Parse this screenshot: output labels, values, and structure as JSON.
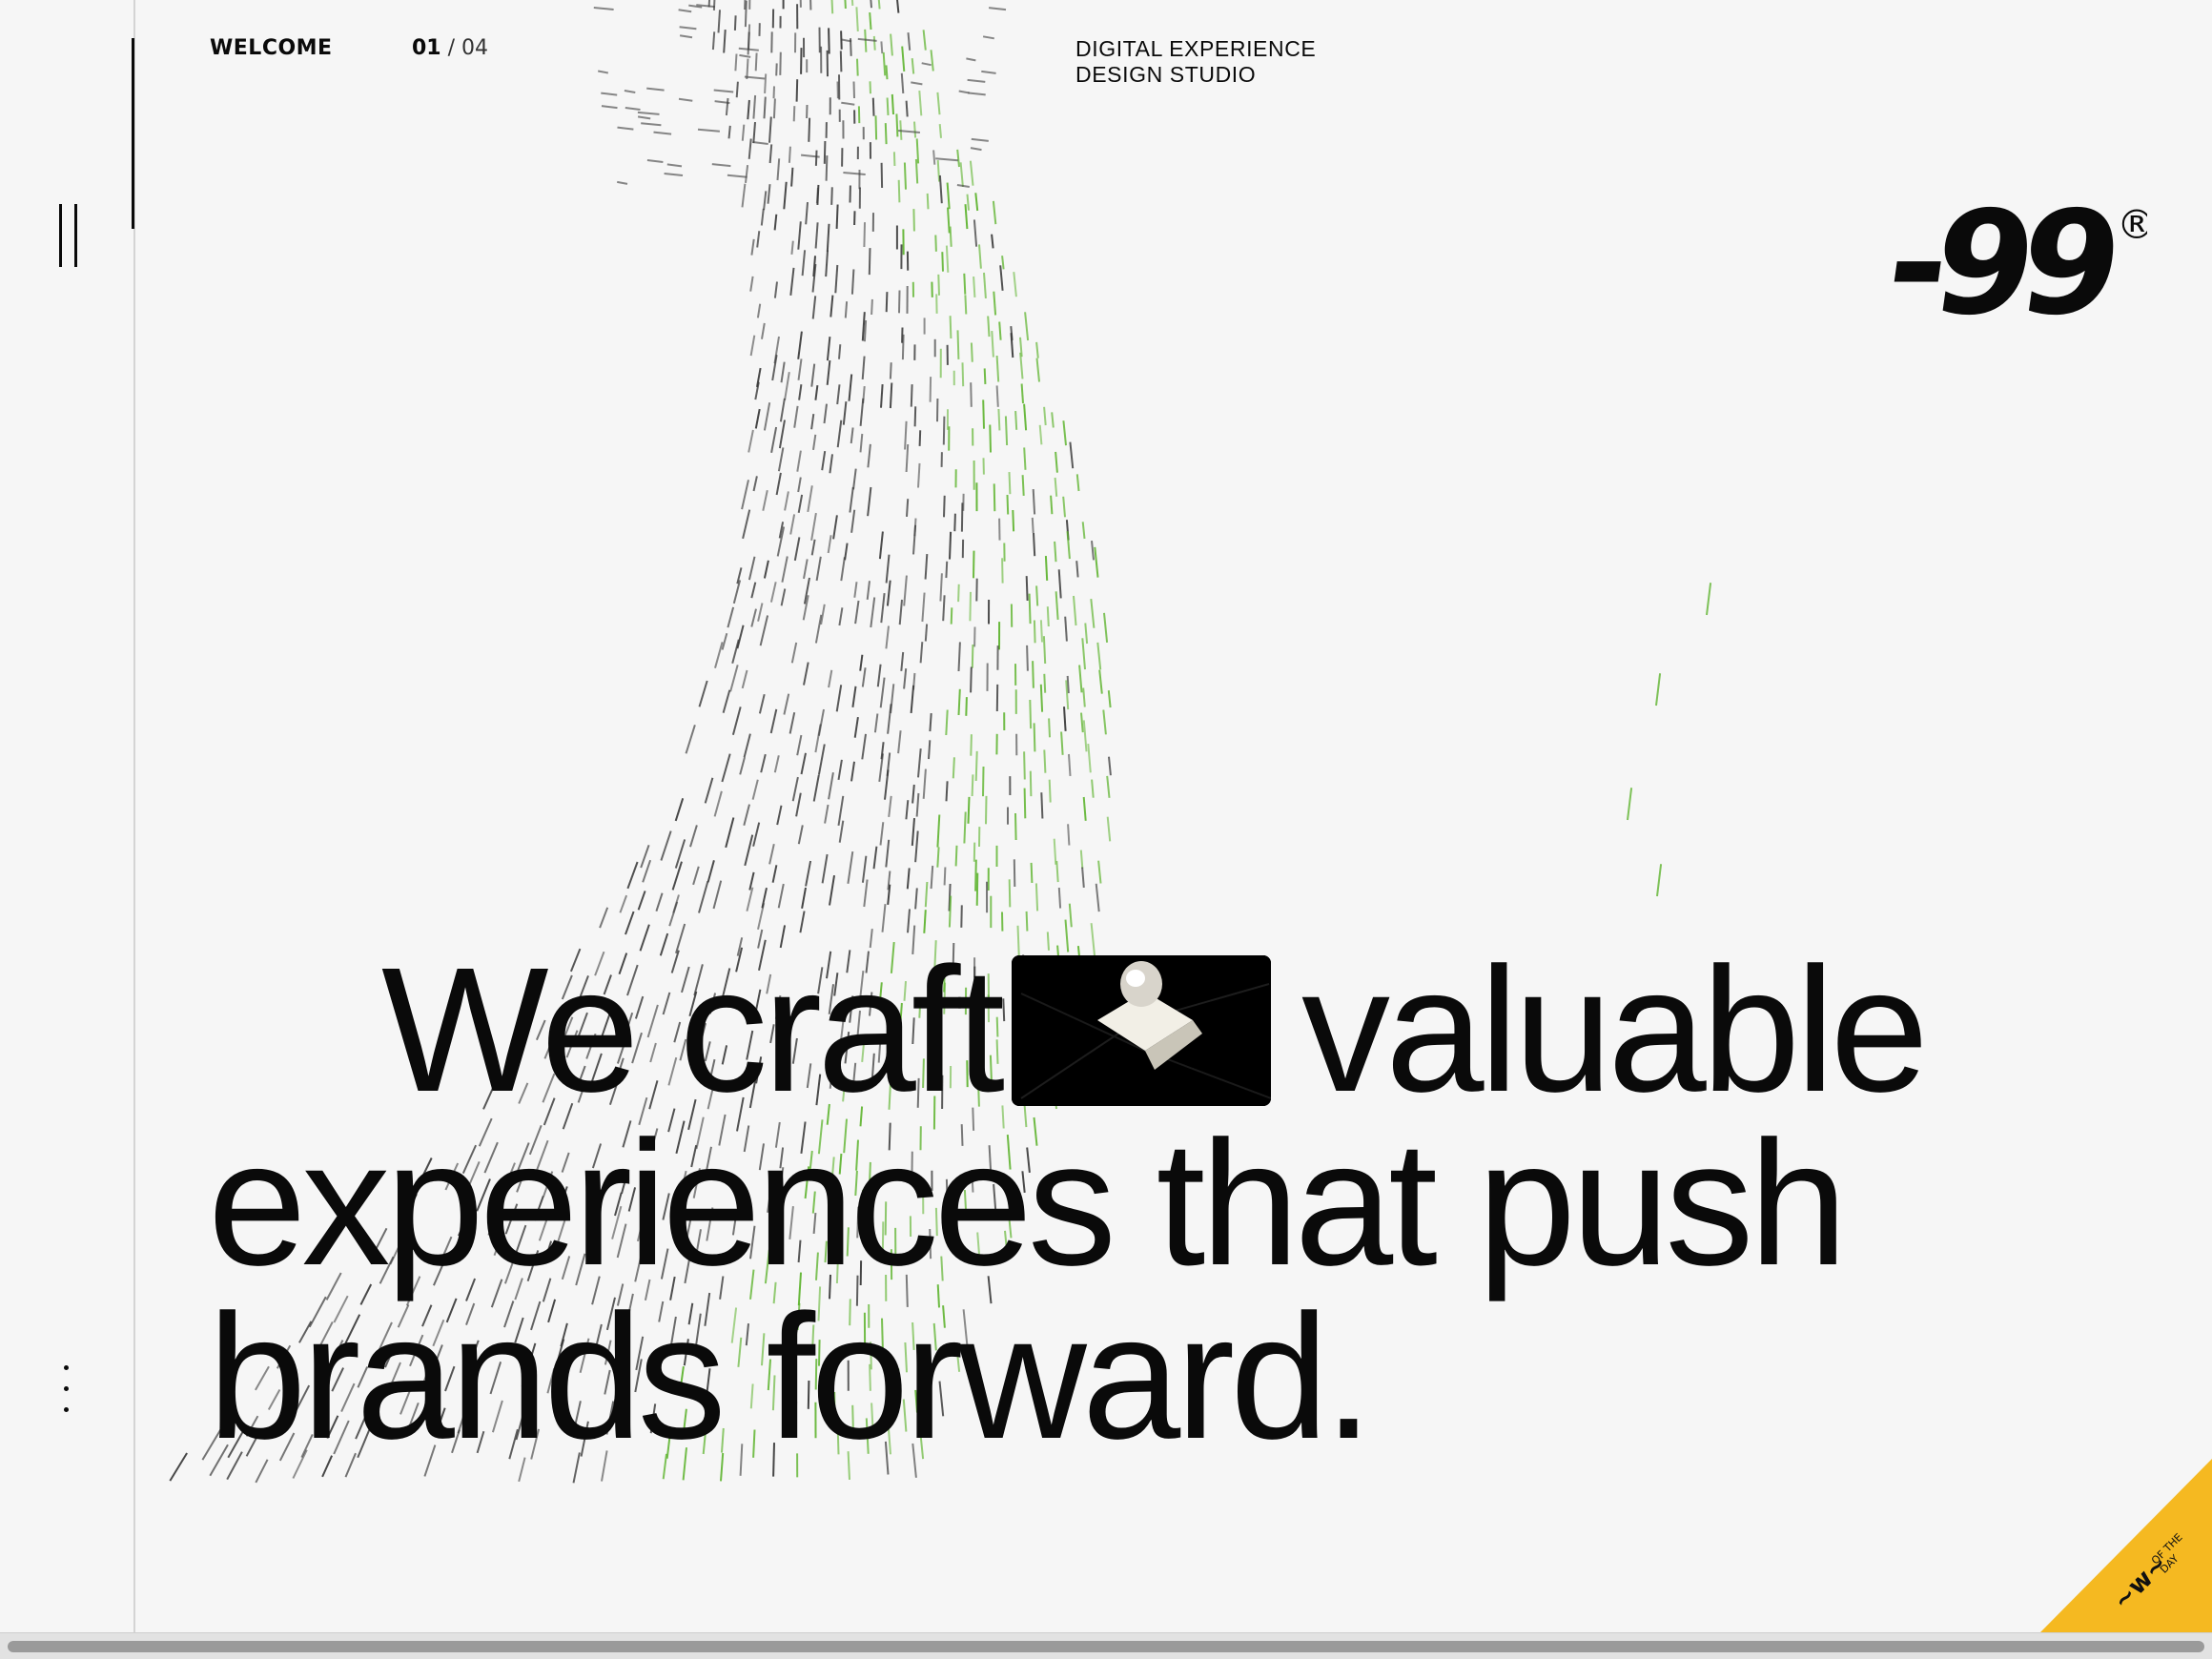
{
  "header": {
    "welcome_label": "WELCOME",
    "pager": {
      "current": "01",
      "separator": "/",
      "total": "04"
    },
    "tagline": {
      "line1": "DIGITAL EXPERIENCE",
      "line2": "DESIGN STUDIO"
    }
  },
  "logo": {
    "text": "-99",
    "mark": "®"
  },
  "hero": {
    "line1_before": "We craft",
    "line1_after": "valuable",
    "line2": "experiences that push",
    "line3": "brands forward."
  },
  "rail": {
    "top_icon": "pause-icon",
    "bottom_icon": "more-vertical-icon"
  },
  "badge": {
    "brand": "awwwards",
    "text1": "OF THE",
    "text2": "DAY",
    "color": "#f5b921"
  },
  "colors": {
    "background": "#f6f6f6",
    "text": "#0a0a0a",
    "particle_green": "#5fb430",
    "particle_dark": "#3a3a3a"
  }
}
